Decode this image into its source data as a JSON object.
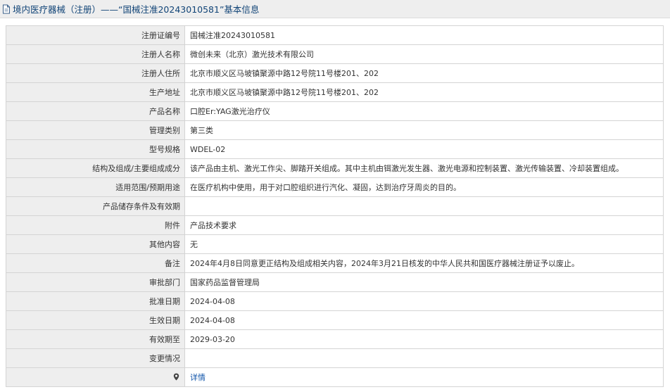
{
  "header": {
    "title": "境内医疗器械（注册）——“国械注准20243010581”基本信息",
    "icon": "document-icon"
  },
  "rows": [
    {
      "label": "注册证编号",
      "value": "国械注准20243010581"
    },
    {
      "label": "注册人名称",
      "value": "微创未来（北京）激光技术有限公司"
    },
    {
      "label": "注册人住所",
      "value": "北京市顺义区马坡镇聚源中路12号院11号楼201、202"
    },
    {
      "label": "生产地址",
      "value": "北京市顺义区马坡镇聚源中路12号院11号楼201、202"
    },
    {
      "label": "产品名称",
      "value": "口腔Er:YAG激光治疗仪"
    },
    {
      "label": "管理类别",
      "value": "第三类"
    },
    {
      "label": "型号规格",
      "value": "WDEL-02"
    },
    {
      "label": "结构及组成/主要组成成分",
      "value": "该产品由主机、激光工作尖、脚踏开关组成。其中主机由铒激光发生器、激光电源和控制装置、激光传输装置、冷却装置组成。"
    },
    {
      "label": "适用范围/预期用途",
      "value": "在医疗机构中使用，用于对口腔组织进行汽化、凝固，达到治疗牙周炎的目的。"
    },
    {
      "label": "产品储存条件及有效期",
      "value": ""
    },
    {
      "label": "附件",
      "value": "产品技术要求"
    },
    {
      "label": "其他内容",
      "value": "无"
    },
    {
      "label": "备注",
      "value": "2024年4月8日同意更正结构及组成相关内容，2024年3月21日核发的中华人民共和国医疗器械注册证予以废止。"
    },
    {
      "label": "审批部门",
      "value": "国家药品监督管理局"
    },
    {
      "label": "批准日期",
      "value": "2024-04-08"
    },
    {
      "label": "生效日期",
      "value": "2024-04-08"
    },
    {
      "label": "有效期至",
      "value": "2029-03-20"
    },
    {
      "label": "变更情况",
      "value": ""
    }
  ],
  "detail": {
    "icon": "map-pin-icon",
    "link_label": "详情"
  },
  "colors": {
    "header_bg": "#eeeeee",
    "label_bg": "#eeeeee",
    "border": "#d4d4d4",
    "title_text": "#114477",
    "link": "#1155aa"
  }
}
